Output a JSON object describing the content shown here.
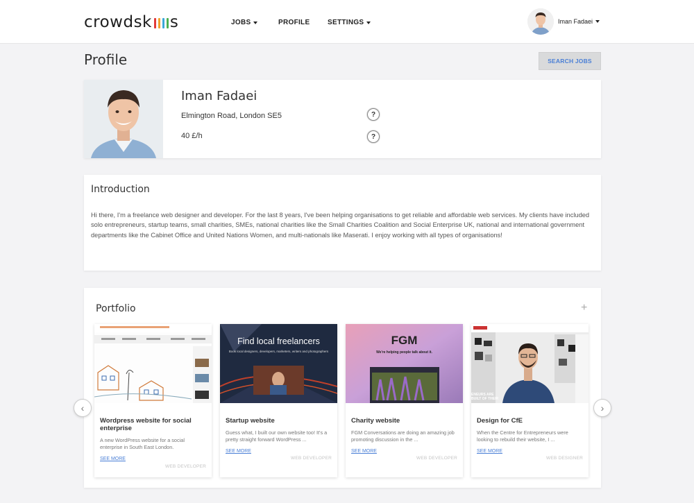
{
  "nav": {
    "brand": "crowdsk",
    "brand_suffix": "s",
    "brand_bar_colors": [
      "#e23a3a",
      "#f2a22d",
      "#3aa8d8",
      "#4cb050"
    ],
    "items": [
      {
        "label": "JOBS",
        "has_caret": true
      },
      {
        "label": "PROFILE",
        "has_caret": false
      },
      {
        "label": "SETTINGS",
        "has_caret": true
      }
    ],
    "user_name": "Iman Fadaei"
  },
  "page": {
    "title": "Profile",
    "search_button": "SEARCH JOBS"
  },
  "profile": {
    "name": "Iman Fadaei",
    "address": "Elmington Road, London SE5",
    "rate": "40 £/h",
    "help_icon": "?"
  },
  "intro": {
    "title": "Introduction",
    "text": "Hi there, I'm a freelance web designer and developer.  For the last 8 years, I've been helping organisations to get reliable and affordable web services.  My clients have included solo entrepreneurs, startup teams, small charities, SMEs, national charities like the Small Charities Coalition and Social Enterprise UK, national and international government departments like the Cabinet Office and United Nations Women, and multi-nationals like Maserati.  I enjoy working with all types of organisations!"
  },
  "portfolio": {
    "title": "Portfolio",
    "add_icon": "+",
    "prev_icon": "‹",
    "next_icon": "›",
    "items": [
      {
        "title": "Wordpress website for social enterprise",
        "desc": "A new WordPress website for a social enterprise in South East London.",
        "more": "SEE MORE",
        "tag": "WEB DEVELOPER"
      },
      {
        "title": "Startup website",
        "desc": "Guess what, I built our own website too! It's a pretty straight forward WordPress  ...",
        "more": "SEE MORE",
        "tag": "WEB DEVELOPER",
        "thumb_heading": "Find local freelancers",
        "thumb_sub": "Book local designers, developers, marketers, writers and photographers"
      },
      {
        "title": "Charity website",
        "desc": "FGM Conversations are doing an amazing job promoting discussion in the         ...",
        "more": "SEE MORE",
        "tag": "WEB DEVELOPER",
        "thumb_heading": "FGM",
        "thumb_sub": "We're helping people talk about it."
      },
      {
        "title": "Design for CfE",
        "desc": "When the Centre for Entrepreneurs were looking to rebuild their website, I         ...",
        "more": "SEE MORE",
        "tag": "WEB DESIGNER",
        "thumb_text": "ENEURS ARE\nBUILT OF THEIR"
      }
    ]
  }
}
